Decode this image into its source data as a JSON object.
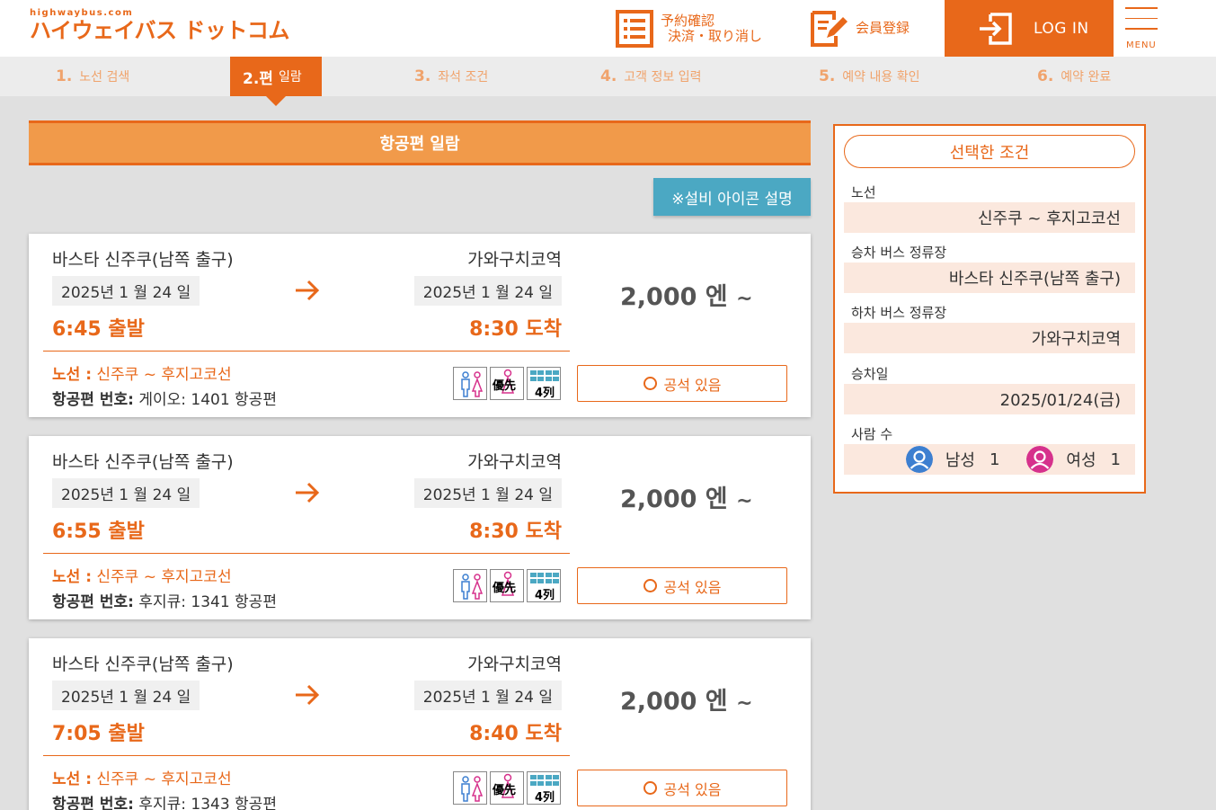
{
  "header": {
    "logo_small": "highwaybus.com",
    "logo_main": "ハイウェイバス ドットコム",
    "reserve_line1": "予約確認",
    "reserve_line2": "決済・取り消し",
    "member_label": "会員登録",
    "login_label": "LOG IN",
    "menu_label": "MENU"
  },
  "steps": [
    {
      "num": "1.",
      "label": "노선 검색"
    },
    {
      "num": "2.편",
      "label": "일람"
    },
    {
      "num": "3.",
      "label": "좌석 조건"
    },
    {
      "num": "4.",
      "label": "고객 정보 입력"
    },
    {
      "num": "5.",
      "label": "예약 내용 확인"
    },
    {
      "num": "6.",
      "label": "예약 완료"
    }
  ],
  "list": {
    "title": "항공편 일람",
    "icon_explain": "※설비 아이콘 설명",
    "route_prefix": "노선 :",
    "flight_prefix": "항공편 번호:",
    "seat_label": "공석 있음",
    "price_tilde": "~",
    "icon_priority": "優先",
    "icon_rows": "4列"
  },
  "flights": [
    {
      "from_stop": "바스타 신주쿠(남쪽 출구)",
      "to_stop": "가와구치코역",
      "dep_date": "2025년 1 월 24 일",
      "arr_date": "2025년 1 월 24 일",
      "dep_time": "6:45 출발",
      "arr_time": "8:30 도착",
      "price": "2,000 엔",
      "route": "신주쿠 ~ 후지고코선",
      "flight_no": "게이오: 1401 항공편"
    },
    {
      "from_stop": "바스타 신주쿠(남쪽 출구)",
      "to_stop": "가와구치코역",
      "dep_date": "2025년 1 월 24 일",
      "arr_date": "2025년 1 월 24 일",
      "dep_time": "6:55 출발",
      "arr_time": "8:30 도착",
      "price": "2,000 엔",
      "route": "신주쿠 ~ 후지고코선",
      "flight_no": "후지큐: 1341 항공편"
    },
    {
      "from_stop": "바스타 신주쿠(남쪽 출구)",
      "to_stop": "가와구치코역",
      "dep_date": "2025년 1 월 24 일",
      "arr_date": "2025년 1 월 24 일",
      "dep_time": "7:05 출발",
      "arr_time": "8:40 도착",
      "price": "2,000 엔",
      "route": "신주쿠 ~ 후지고코선",
      "flight_no": "후지큐: 1343 항공편"
    }
  ],
  "sidebar": {
    "title": "선택한 조건",
    "route_label": "노선",
    "route_value": "신주쿠 ~ 후지고코선",
    "board_label": "승차 버스 정류장",
    "board_value": "바스타 신주쿠(남쪽 출구)",
    "alight_label": "하차 버스 정류장",
    "alight_value": "가와구치코역",
    "date_label": "승차일",
    "date_value": "2025/01/24(금)",
    "people_label": "사람 수",
    "male_label": "남성",
    "male_count": "1",
    "female_label": "여성",
    "female_count": "1"
  },
  "colors": {
    "brand": "#e8681a",
    "title_bar": "#f19a4a",
    "info_button": "#4ba8c3",
    "sidebar_value_bg": "#fbe8de",
    "male_avatar": "#3d7fd0",
    "female_avatar": "#d6318c"
  }
}
